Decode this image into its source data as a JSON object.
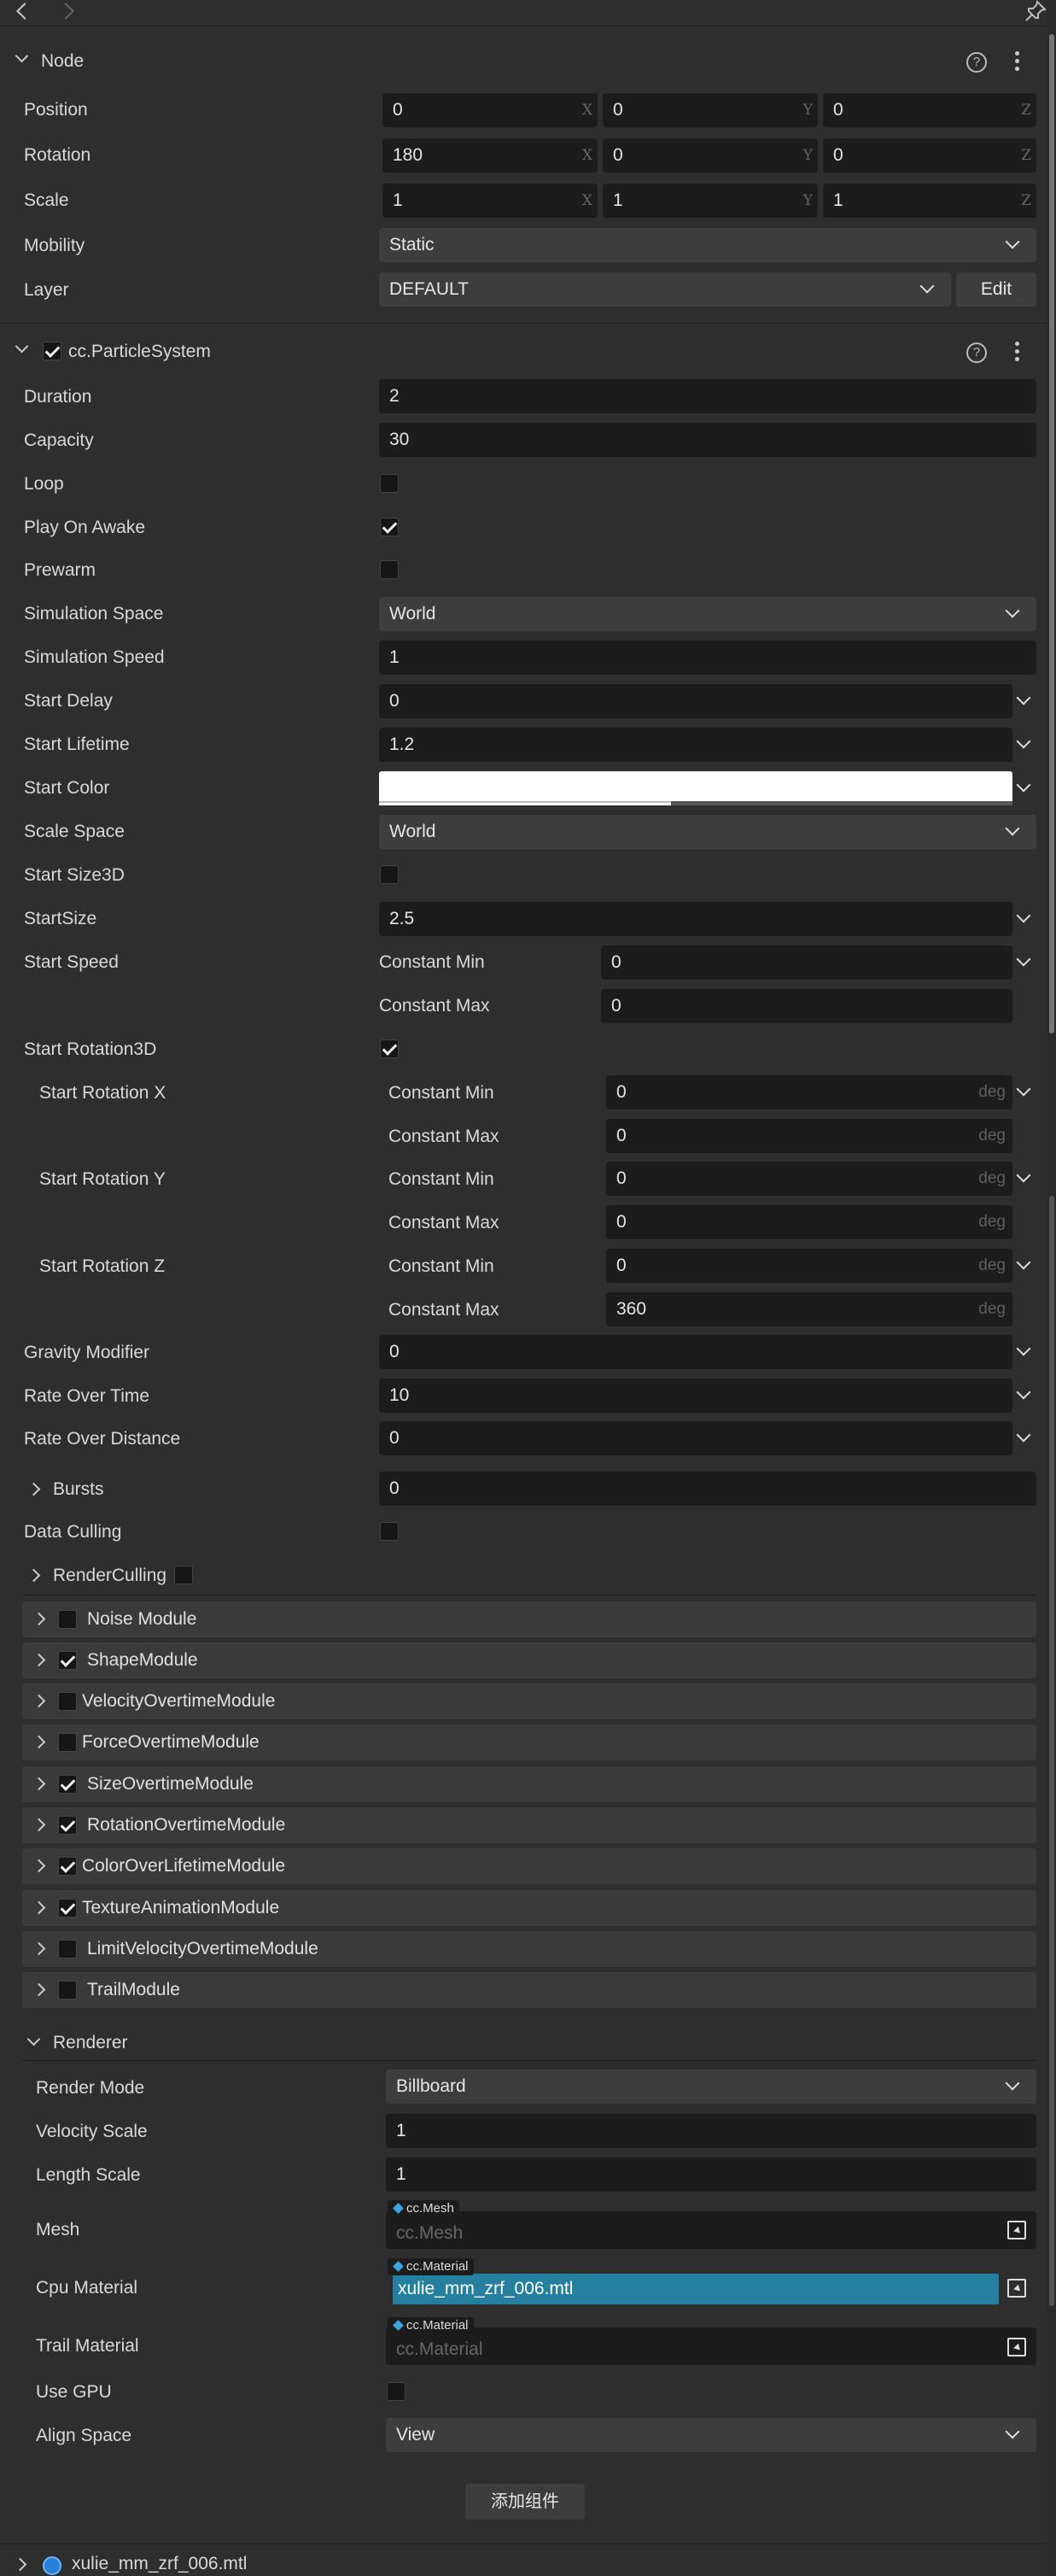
{
  "toolbar": {
    "back_icon": "chevron-left-icon",
    "forward_icon": "chevron-right-icon",
    "pin_icon": "pin-icon"
  },
  "node": {
    "title": "Node",
    "position": {
      "label": "Position",
      "x": "0",
      "y": "0",
      "z": "0"
    },
    "rotation": {
      "label": "Rotation",
      "x": "180",
      "y": "0",
      "z": "0"
    },
    "scale": {
      "label": "Scale",
      "x": "1",
      "y": "1",
      "z": "1"
    },
    "axes": {
      "x": "X",
      "y": "Y",
      "z": "Z"
    },
    "mobility": {
      "label": "Mobility",
      "value": "Static"
    },
    "layer": {
      "label": "Layer",
      "value": "DEFAULT",
      "edit": "Edit"
    }
  },
  "ps": {
    "title": "cc.ParticleSystem",
    "help": "?",
    "duration": {
      "label": "Duration",
      "value": "2"
    },
    "capacity": {
      "label": "Capacity",
      "value": "30"
    },
    "loop": {
      "label": "Loop",
      "checked": false
    },
    "play_on_awake": {
      "label": "Play On Awake",
      "checked": true
    },
    "prewarm": {
      "label": "Prewarm",
      "checked": false
    },
    "sim_space": {
      "label": "Simulation Space",
      "value": "World"
    },
    "sim_speed": {
      "label": "Simulation Speed",
      "value": "1"
    },
    "start_delay": {
      "label": "Start Delay",
      "value": "0"
    },
    "start_lifetime": {
      "label": "Start Lifetime",
      "value": "1.2"
    },
    "start_color": {
      "label": "Start Color",
      "color": "#ffffff"
    },
    "scale_space": {
      "label": "Scale Space",
      "value": "World"
    },
    "start_size3d": {
      "label": "Start Size3D",
      "checked": false
    },
    "start_size": {
      "label": "StartSize",
      "value": "2.5"
    },
    "start_speed": {
      "label": "Start Speed",
      "min_label": "Constant Min",
      "min": "0",
      "max_label": "Constant Max",
      "max": "0"
    },
    "start_rotation3d": {
      "label": "Start Rotation3D",
      "checked": true
    },
    "rot_x": {
      "label": "Start Rotation X",
      "min_label": "Constant Min",
      "min": "0",
      "max_label": "Constant Max",
      "max": "0"
    },
    "rot_y": {
      "label": "Start Rotation Y",
      "min_label": "Constant Min",
      "min": "0",
      "max_label": "Constant Max",
      "max": "0"
    },
    "rot_z": {
      "label": "Start Rotation Z",
      "min_label": "Constant Min",
      "min": "0",
      "max_label": "Constant Max",
      "max": "360"
    },
    "unit": "deg",
    "gravity": {
      "label": "Gravity Modifier",
      "value": "0"
    },
    "rate_time": {
      "label": "Rate Over Time",
      "value": "10"
    },
    "rate_distance": {
      "label": "Rate Over Distance",
      "value": "0"
    },
    "bursts": {
      "label": "Bursts",
      "value": "0"
    },
    "data_culling": {
      "label": "Data Culling",
      "checked": false
    },
    "render_culling": {
      "label": "RenderCulling",
      "checked": false
    },
    "modules": [
      {
        "label": "Noise Module",
        "checked": false
      },
      {
        "label": "ShapeModule",
        "checked": true
      },
      {
        "label": "VelocityOvertimeModule",
        "checked": false
      },
      {
        "label": "ForceOvertimeModule",
        "checked": false
      },
      {
        "label": "SizeOvertimeModule",
        "checked": true
      },
      {
        "label": "RotationOvertimeModule",
        "checked": true
      },
      {
        "label": "ColorOverLifetimeModule",
        "checked": true
      },
      {
        "label": "TextureAnimationModule",
        "checked": true
      },
      {
        "label": "LimitVelocityOvertimeModule",
        "checked": false
      },
      {
        "label": "TrailModule",
        "checked": false
      }
    ]
  },
  "renderer": {
    "title": "Renderer",
    "render_mode": {
      "label": "Render Mode",
      "value": "Billboard"
    },
    "velocity_scale": {
      "label": "Velocity Scale",
      "value": "1"
    },
    "length_scale": {
      "label": "Length Scale",
      "value": "1"
    },
    "mesh": {
      "label": "Mesh",
      "tag": "cc.Mesh",
      "placeholder": "cc.Mesh"
    },
    "cpu_material": {
      "label": "Cpu Material",
      "tag": "cc.Material",
      "value": "xulie_mm_zrf_006.mtl"
    },
    "trail_material": {
      "label": "Trail Material",
      "tag": "cc.Material",
      "placeholder": "cc.Material"
    },
    "use_gpu": {
      "label": "Use GPU",
      "checked": false
    },
    "align_space": {
      "label": "Align Space",
      "value": "View"
    }
  },
  "add_component": "添加组件",
  "asset": {
    "name": "xulie_mm_zrf_006.mtl",
    "icon": "material-globe-icon"
  },
  "colors": {
    "accent": "#2a7fa8",
    "bg": "#2e2e2e",
    "field": "#1c1c1c"
  }
}
